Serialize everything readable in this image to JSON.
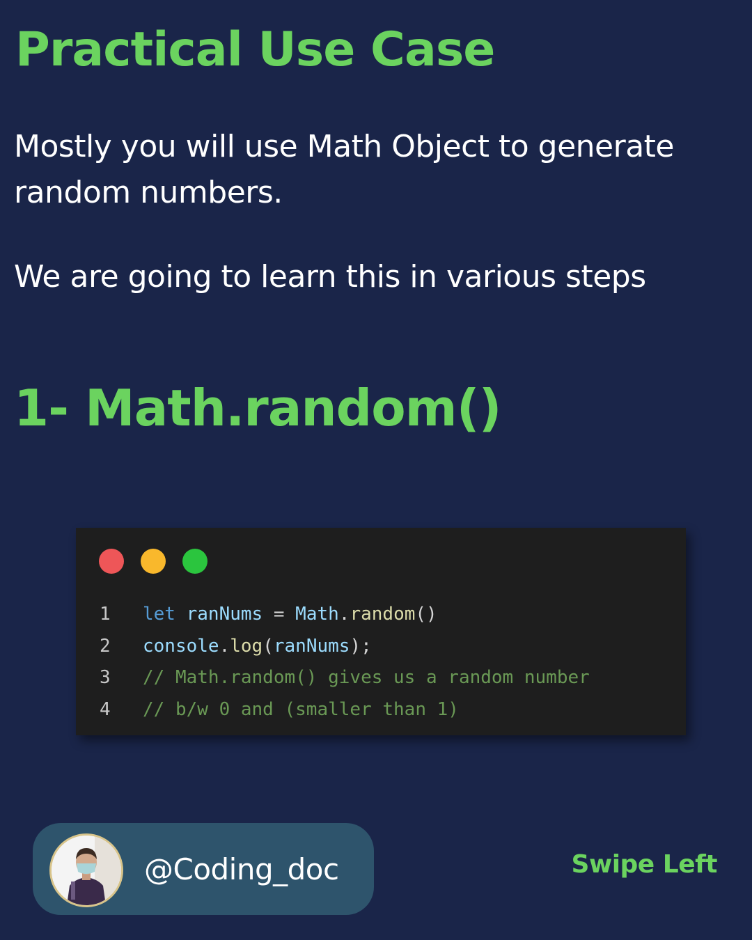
{
  "title": "Practical Use Case",
  "paragraphs": {
    "first": "Mostly you will use Math Object to generate random numbers.",
    "second": "We are going to learn this in various steps"
  },
  "step_heading": "1- Math.random()",
  "code_window": {
    "dots": {
      "red": "#ee5658",
      "yellow": "#f9b82c",
      "green": "#2bc53e"
    },
    "lines": [
      {
        "number": "1",
        "tokens": [
          {
            "text": "let",
            "kind": "kw"
          },
          {
            "text": " ",
            "kind": "op"
          },
          {
            "text": "ranNums",
            "kind": "var"
          },
          {
            "text": " = ",
            "kind": "op"
          },
          {
            "text": "Math",
            "kind": "obj"
          },
          {
            "text": ".",
            "kind": "punc"
          },
          {
            "text": "random",
            "kind": "fn"
          },
          {
            "text": "()",
            "kind": "punc"
          }
        ]
      },
      {
        "number": "2",
        "tokens": [
          {
            "text": "console",
            "kind": "var"
          },
          {
            "text": ".",
            "kind": "punc"
          },
          {
            "text": "log",
            "kind": "fn"
          },
          {
            "text": "(",
            "kind": "punc"
          },
          {
            "text": "ranNums",
            "kind": "var"
          },
          {
            "text": ");",
            "kind": "punc"
          }
        ]
      },
      {
        "number": "3",
        "tokens": [
          {
            "text": "// Math.random() gives us a random number",
            "kind": "comment"
          }
        ]
      },
      {
        "number": "4",
        "tokens": [
          {
            "text": "// b/w 0 and (smaller than 1)",
            "kind": "comment"
          }
        ]
      }
    ]
  },
  "profile": {
    "handle": "@Coding_doc",
    "avatar_icon": "profile-photo-icon"
  },
  "swipe_label": "Swipe Left"
}
